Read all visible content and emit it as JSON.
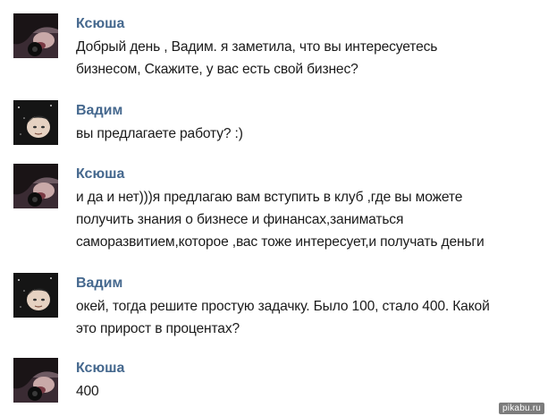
{
  "messages": [
    {
      "author": "Ксюша",
      "text": "Добрый день , Вадим. я заметила, что вы интересуетесь\nбизнесом, Скажите, у вас есть свой бизнес?"
    },
    {
      "author": "Вадим",
      "text": "вы предлагаете работу? :)"
    },
    {
      "author": "Ксюша",
      "text": "и да и нет)))я предлагаю вам вступить в клуб ,где вы можете\nполучить знания о бизнесе и финансах,заниматься\nсаморазвитием,которое ,вас тоже интересует,и получать деньги"
    },
    {
      "author": "Вадим",
      "text": "окей, тогда решите простую задачку. Было 100, стало 400. Какой\nэто прирост в процентах?"
    },
    {
      "author": "Ксюша",
      "text": "400"
    }
  ],
  "watermark": "pikabu.ru"
}
